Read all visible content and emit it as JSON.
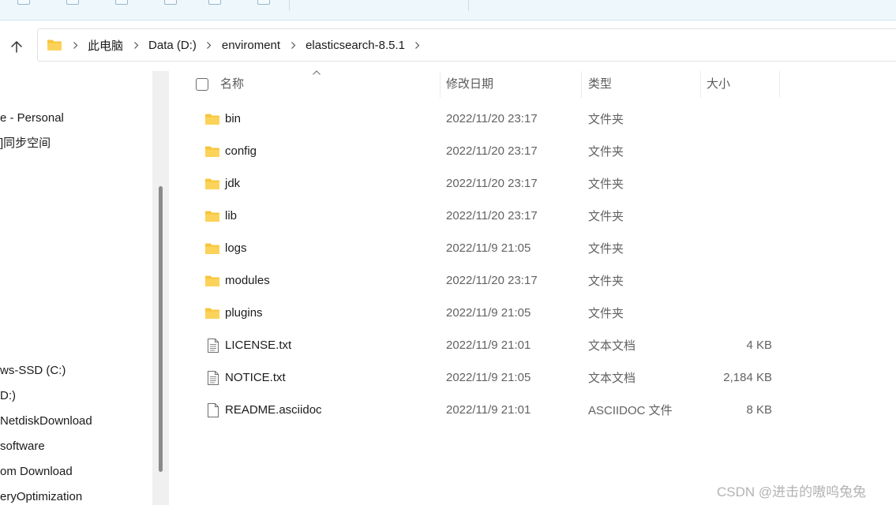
{
  "address": {
    "crumbs": [
      "此电脑",
      "Data (D:)",
      "enviroment",
      "elasticsearch-8.5.1"
    ]
  },
  "nav": {
    "items": [
      "e - Personal",
      "]同步空间",
      "ws-SSD (C:)",
      "D:)",
      "NetdiskDownload",
      " software",
      "om Download",
      "eryOptimization"
    ]
  },
  "columns": {
    "name": "名称",
    "date": "修改日期",
    "type": "类型",
    "size": "大小"
  },
  "files": [
    {
      "name": "bin",
      "date": "2022/11/20 23:17",
      "type": "文件夹",
      "size": "",
      "icon": "folder-icon"
    },
    {
      "name": "config",
      "date": "2022/11/20 23:17",
      "type": "文件夹",
      "size": "",
      "icon": "folder-icon"
    },
    {
      "name": "jdk",
      "date": "2022/11/20 23:17",
      "type": "文件夹",
      "size": "",
      "icon": "folder-icon"
    },
    {
      "name": "lib",
      "date": "2022/11/20 23:17",
      "type": "文件夹",
      "size": "",
      "icon": "folder-icon"
    },
    {
      "name": "logs",
      "date": "2022/11/9 21:05",
      "type": "文件夹",
      "size": "",
      "icon": "folder-icon"
    },
    {
      "name": "modules",
      "date": "2022/11/20 23:17",
      "type": "文件夹",
      "size": "",
      "icon": "folder-icon"
    },
    {
      "name": "plugins",
      "date": "2022/11/9 21:05",
      "type": "文件夹",
      "size": "",
      "icon": "folder-icon"
    },
    {
      "name": "LICENSE.txt",
      "date": "2022/11/9 21:01",
      "type": "文本文档",
      "size": "4 KB",
      "icon": "text-file-icon"
    },
    {
      "name": "NOTICE.txt",
      "date": "2022/11/9 21:05",
      "type": "文本文档",
      "size": "2,184 KB",
      "icon": "text-file-icon"
    },
    {
      "name": "README.asciidoc",
      "date": "2022/11/9 21:01",
      "type": "ASCIIDOC 文件",
      "size": "8 KB",
      "icon": "file-icon"
    }
  ],
  "watermark": "CSDN @进击的嗷呜兔兔",
  "colors": {
    "folder": "#f8c53a",
    "toolbar_bg": "#edf7fc"
  }
}
